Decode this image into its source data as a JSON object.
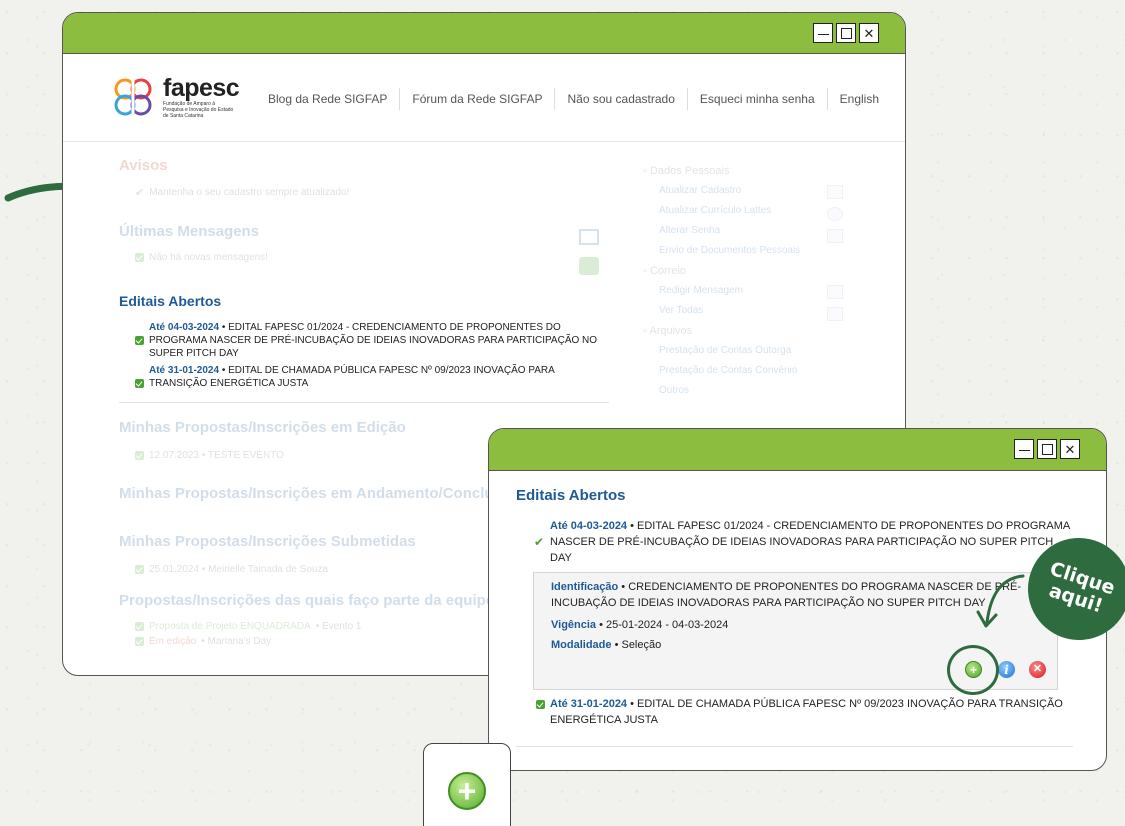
{
  "window_controls": {
    "minimize": "—",
    "maximize": "□",
    "close": "✕"
  },
  "brand": {
    "name": "fapesc",
    "subtitle": "Fundação de Amparo à Pesquisa e Inovação do Estado de Santa Catarina"
  },
  "topnav": [
    "Blog da Rede SIGFAP",
    "Fórum da Rede SIGFAP",
    "Não sou cadastrado",
    "Esqueci minha senha",
    "English"
  ],
  "avisos": {
    "title": "Avisos",
    "item": "Mantenha o seu cadastro sempre atualizado!"
  },
  "mensagens": {
    "title": "Últimas Mensagens",
    "item": "Não há novas mensagens!"
  },
  "editais": {
    "title": "Editais Abertos",
    "items": [
      {
        "date": "Até 04-03-2024",
        "text": " • EDITAL FAPESC 01/2024 - CREDENCIAMENTO DE PROPONENTES DO PROGRAMA NASCER DE PRÉ-INCUBAÇÃO DE IDEIAS INOVADORAS PARA PARTICIPAÇÃO NO SUPER PITCH DAY"
      },
      {
        "date": "Até 31-01-2024",
        "text": " • EDITAL DE CHAMADA PÚBLICA FAPESC Nº 09/2023 INOVAÇÃO PARA TRANSIÇÃO ENERGÉTICA JUSTA"
      }
    ]
  },
  "propostas_edicao": {
    "title": "Minhas Propostas/Inscrições em Edição",
    "item": "12.07.2023 • TESTE EVENTO"
  },
  "propostas_andamento": {
    "title": "Minhas Propostas/Inscrições em Andamento/Concluída"
  },
  "propostas_submetidas": {
    "title": "Minhas Propostas/Inscrições Submetidas",
    "item": "25.01.2024 • Meirielle Tainada de Souza"
  },
  "propostas_equipe": {
    "title": "Propostas/Inscrições das quais faço parte da equipe",
    "items": [
      {
        "status": "Proposta de Projeto ENQUADRADA",
        "text": " • Evento 1"
      },
      {
        "status": "Em edição",
        "text": " • Mariana's Day"
      }
    ]
  },
  "sidebar": {
    "groups": [
      {
        "title": "Dados Pessoais",
        "items": [
          "Atualizar Cadastro",
          "Atualizar Currículo Lattes",
          "Alterar Senha",
          "Envio de Documentos Pessoais"
        ]
      },
      {
        "title": "Correio",
        "items": [
          "Redigir Mensagem",
          "Ver Todas"
        ]
      },
      {
        "title": "Arquivos",
        "items": [
          "Prestação de Contas Outorga",
          "Prestação de Contas Convênio",
          "Outros"
        ]
      }
    ]
  },
  "detail": {
    "identificacao_label": "Identificação",
    "identificacao_value": " • CREDENCIAMENTO DE PROPONENTES DO PROGRAMA NASCER DE PRÉ-INCUBAÇÃO DE IDEIAS INOVADORAS PARA PARTICIPAÇÃO NO SUPER PITCH DAY",
    "vigencia_label": "Vigência",
    "vigencia_value": " • 25-01-2024 - 04-03-2024",
    "modalidade_label": "Modalidade",
    "modalidade_value": " • Seleção",
    "actions": {
      "add": "+",
      "info": "i",
      "delete": "✕"
    }
  },
  "callout": {
    "line1": "Clique",
    "line2": "aqui!"
  },
  "colors": {
    "titlebar": "#8cbd3f",
    "link_blue": "#1f5a96",
    "callout_green": "#2e6b3e",
    "check_green": "#4aa232"
  }
}
